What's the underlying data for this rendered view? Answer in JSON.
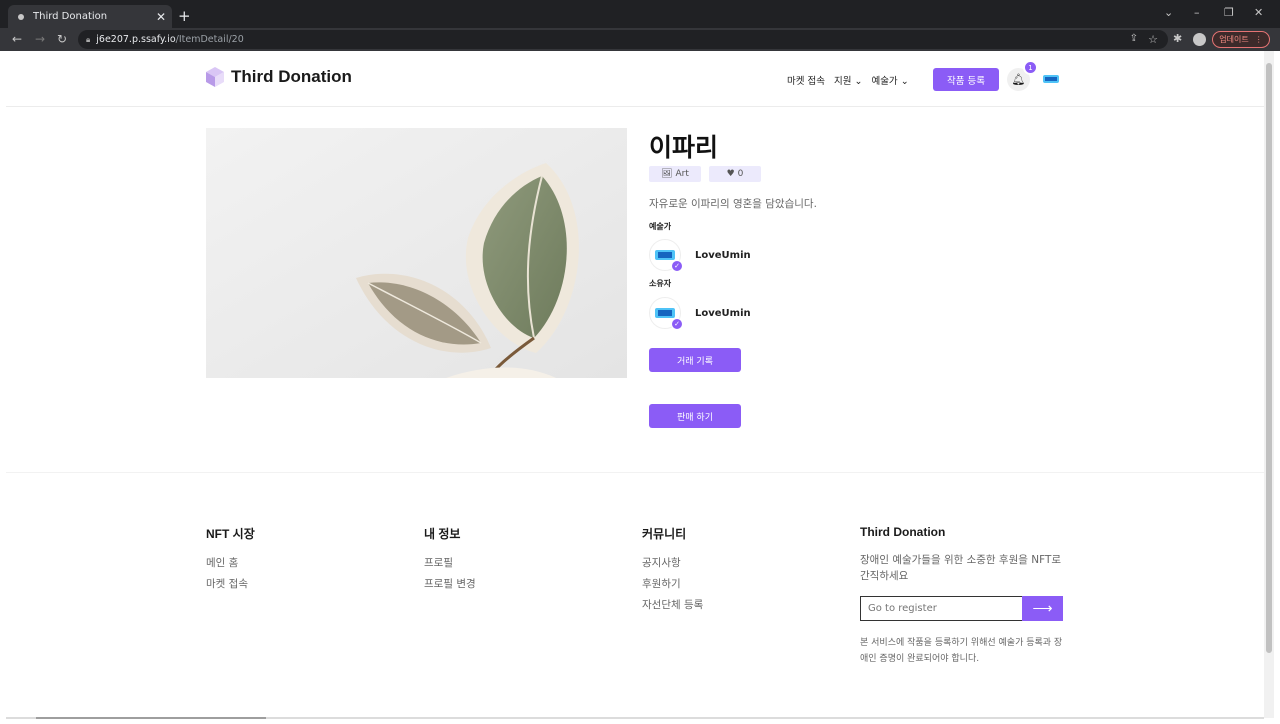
{
  "browser": {
    "tab_title": "Third Donation",
    "tab_close": "✕",
    "new_tab": "+",
    "url_host": "j6e207.p.ssafy.io",
    "url_path": "/ItemDetail/20",
    "update_label": "업데이트",
    "update_menu": "⋮"
  },
  "header": {
    "logo_text": "Third Donation",
    "menu": [
      "마켓 접속",
      "지원",
      "예술가"
    ],
    "register_label": "작품 등록",
    "notif_count": "1"
  },
  "item": {
    "title": "이파리",
    "category": "Art",
    "likes": "0",
    "description": "자유로운 이파리의 영혼을 담았습니다.",
    "artist_label": "예술가",
    "artist_name": "LoveUmin",
    "owner_label": "소유자",
    "owner_name": "LoveUmin",
    "history_button": "거래 기록",
    "sell_button": "판매 하기"
  },
  "footer": {
    "col1": {
      "title": "NFT 시장",
      "links": [
        "메인 홈",
        "마켓 접속"
      ]
    },
    "col2": {
      "title": "내 정보",
      "links": [
        "프로필",
        "프로필 변경"
      ]
    },
    "col3": {
      "title": "커뮤니티",
      "links": [
        "공지사항",
        "후원하기",
        "자선단체 등록"
      ]
    },
    "col4": {
      "title": "Third Donation",
      "text": "장애인 예술가들을 위한 소중한 후원을 NFT로 간직하세요",
      "input_placeholder": "Go to register",
      "note": "본 서비스에 작품을 등록하기 위해선 예술가 등록과 장애인 증명이 완료되어야 합니다."
    }
  },
  "colors": {
    "accent": "#8b5cf6",
    "chip_bg": "#eceafc"
  },
  "icons": [
    "lock-icon",
    "bell-icon",
    "heart-icon",
    "image-icon",
    "arrow-right-icon",
    "check-badge-icon"
  ]
}
